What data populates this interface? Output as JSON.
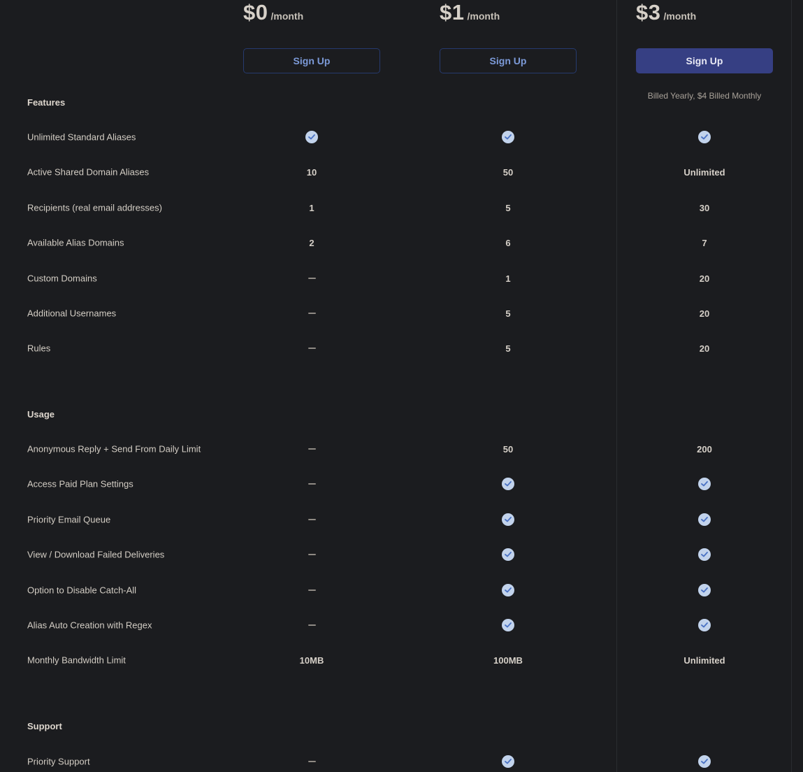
{
  "plans": [
    {
      "price": "$0",
      "period": "/month",
      "signup_label": "Sign Up",
      "style": "outline",
      "note": ""
    },
    {
      "price": "$1",
      "period": "/month",
      "signup_label": "Sign Up",
      "style": "outline",
      "note": ""
    },
    {
      "price": "$3",
      "period": "/month",
      "signup_label": "Sign Up",
      "style": "filled",
      "note": "Billed Yearly, $4 Billed Monthly"
    }
  ],
  "colors": {
    "background": "#1b1c1f",
    "accent_button": "#363f83",
    "outline_border": "#263a6e",
    "check": "#c2d3ec"
  },
  "sections": [
    {
      "title": "Features",
      "rows": [
        {
          "label": "Unlimited Standard Aliases",
          "values": [
            "check-icon",
            "check-icon",
            "check-icon"
          ]
        },
        {
          "label": "Active Shared Domain Aliases",
          "values": [
            "10",
            "50",
            "Unlimited"
          ]
        },
        {
          "label": "Recipients (real email addresses)",
          "values": [
            "1",
            "5",
            "30"
          ]
        },
        {
          "label": "Available Alias Domains",
          "values": [
            "2",
            "6",
            "7"
          ]
        },
        {
          "label": "Custom Domains",
          "values": [
            "dash-icon",
            "1",
            "20"
          ]
        },
        {
          "label": "Additional Usernames",
          "values": [
            "dash-icon",
            "5",
            "20"
          ]
        },
        {
          "label": "Rules",
          "values": [
            "dash-icon",
            "5",
            "20"
          ]
        }
      ]
    },
    {
      "title": "Usage",
      "rows": [
        {
          "label": "Anonymous Reply + Send From Daily Limit",
          "values": [
            "dash-icon",
            "50",
            "200"
          ]
        },
        {
          "label": "Access Paid Plan Settings",
          "values": [
            "dash-icon",
            "check-icon",
            "check-icon"
          ]
        },
        {
          "label": "Priority Email Queue",
          "values": [
            "dash-icon",
            "check-icon",
            "check-icon"
          ]
        },
        {
          "label": "View / Download Failed Deliveries",
          "values": [
            "dash-icon",
            "check-icon",
            "check-icon"
          ]
        },
        {
          "label": "Option to Disable Catch-All",
          "values": [
            "dash-icon",
            "check-icon",
            "check-icon"
          ]
        },
        {
          "label": "Alias Auto Creation with Regex",
          "values": [
            "dash-icon",
            "check-icon",
            "check-icon"
          ]
        },
        {
          "label": "Monthly Bandwidth Limit",
          "values": [
            "10MB",
            "100MB",
            "Unlimited"
          ]
        }
      ]
    },
    {
      "title": "Support",
      "rows": [
        {
          "label": "Priority Support",
          "values": [
            "dash-icon",
            "check-icon",
            "check-icon"
          ]
        }
      ]
    }
  ]
}
